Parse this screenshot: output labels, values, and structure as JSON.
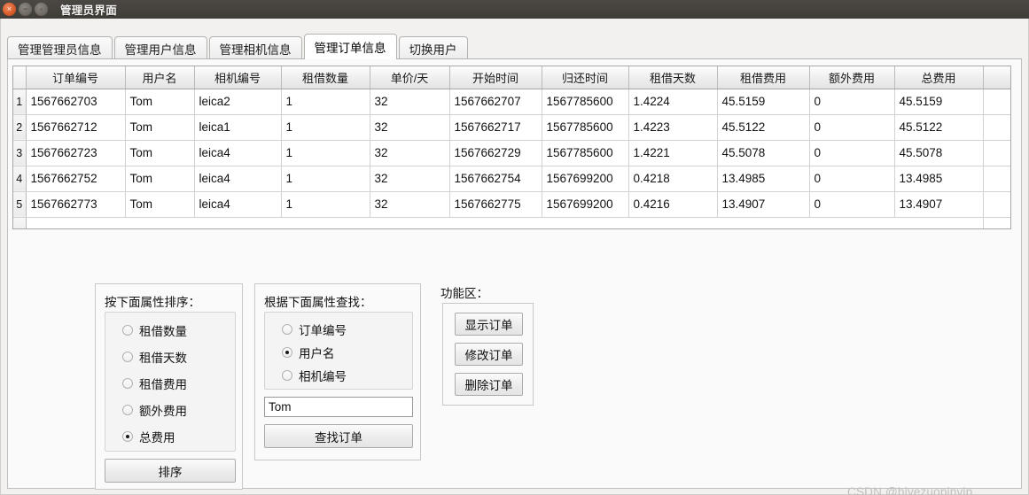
{
  "window": {
    "title": "管理员界面",
    "controls": {
      "close": "×",
      "minimize": "−",
      "maximize": "▫"
    }
  },
  "tabs": [
    {
      "label": "管理管理员信息",
      "active": false
    },
    {
      "label": "管理用户信息",
      "active": false
    },
    {
      "label": "管理相机信息",
      "active": false
    },
    {
      "label": "管理订单信息",
      "active": true
    },
    {
      "label": "切换用户",
      "active": false
    }
  ],
  "table": {
    "columns": [
      "订单编号",
      "用户名",
      "相机编号",
      "租借数量",
      "单价/天",
      "开始时间",
      "归还时间",
      "租借天数",
      "租借费用",
      "额外费用",
      "总费用"
    ],
    "rows": [
      {
        "num": "1",
        "cells": [
          "1567662703",
          "Tom",
          "leica2",
          "1",
          "32",
          "1567662707",
          "1567785600",
          "1.4224",
          "45.5159",
          "0",
          "45.5159"
        ]
      },
      {
        "num": "2",
        "cells": [
          "1567662712",
          "Tom",
          "leica1",
          "1",
          "32",
          "1567662717",
          "1567785600",
          "1.4223",
          "45.5122",
          "0",
          "45.5122"
        ]
      },
      {
        "num": "3",
        "cells": [
          "1567662723",
          "Tom",
          "leica4",
          "1",
          "32",
          "1567662729",
          "1567785600",
          "1.4221",
          "45.5078",
          "0",
          "45.5078"
        ]
      },
      {
        "num": "4",
        "cells": [
          "1567662752",
          "Tom",
          "leica4",
          "1",
          "32",
          "1567662754",
          "1567699200",
          "0.4218",
          "13.4985",
          "0",
          "13.4985"
        ]
      },
      {
        "num": "5",
        "cells": [
          "1567662773",
          "Tom",
          "leica4",
          "1",
          "32",
          "1567662775",
          "1567699200",
          "0.4216",
          "13.4907",
          "0",
          "13.4907"
        ]
      }
    ]
  },
  "sort_panel": {
    "title": "按下面属性排序：",
    "options": [
      {
        "label": "租借数量",
        "selected": false
      },
      {
        "label": "租借天数",
        "selected": false
      },
      {
        "label": "租借费用",
        "selected": false
      },
      {
        "label": "额外费用",
        "selected": false
      },
      {
        "label": "总费用",
        "selected": true
      }
    ],
    "button": "排序"
  },
  "search_panel": {
    "title": "根据下面属性查找：",
    "options": [
      {
        "label": "订单编号",
        "selected": false
      },
      {
        "label": "用户名",
        "selected": true
      },
      {
        "label": "相机编号",
        "selected": false
      }
    ],
    "input_value": "Tom",
    "input_placeholder": "",
    "button": "查找订单"
  },
  "function_panel": {
    "title": "功能区：",
    "buttons": [
      "显示订单",
      "修改订单",
      "删除订单"
    ]
  },
  "watermark": "CSDN @biyezuopinvip",
  "colors": {
    "titlebar": "#403d39",
    "close_button": "#d85a28",
    "panel_bg": "#fafafa",
    "table_header": "#eeeeee"
  }
}
